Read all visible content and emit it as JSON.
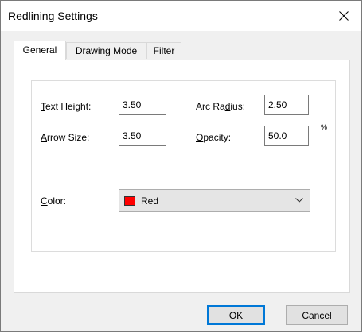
{
  "window": {
    "title": "Redlining Settings",
    "close_icon": "close-icon"
  },
  "tabs": [
    {
      "label": "General",
      "active": true
    },
    {
      "label": "Drawing Mode",
      "active": false
    },
    {
      "label": "Filter",
      "active": false
    }
  ],
  "general": {
    "text_height": {
      "label_mnemonic": "T",
      "label_rest": "ext Height:",
      "value": "3.50"
    },
    "arrow_size": {
      "label_mnemonic": "A",
      "label_rest": "rrow Size:",
      "value": "3.50"
    },
    "arc_radius": {
      "label_pre": "Arc Ra",
      "label_mnemonic": "d",
      "label_rest": "ius:",
      "value": "2.50"
    },
    "opacity": {
      "label_mnemonic": "O",
      "label_rest": "pacity:",
      "value": "50.0",
      "unit": "%"
    },
    "color": {
      "label_mnemonic": "C",
      "label_rest": "olor:",
      "selected": "Red",
      "swatch": "#ff0000",
      "icon": "chevron-down-icon"
    }
  },
  "buttons": {
    "ok": "OK",
    "cancel": "Cancel"
  },
  "colors": {
    "accent": "#0078d7",
    "dialog_bg": "#f0f0f0"
  }
}
